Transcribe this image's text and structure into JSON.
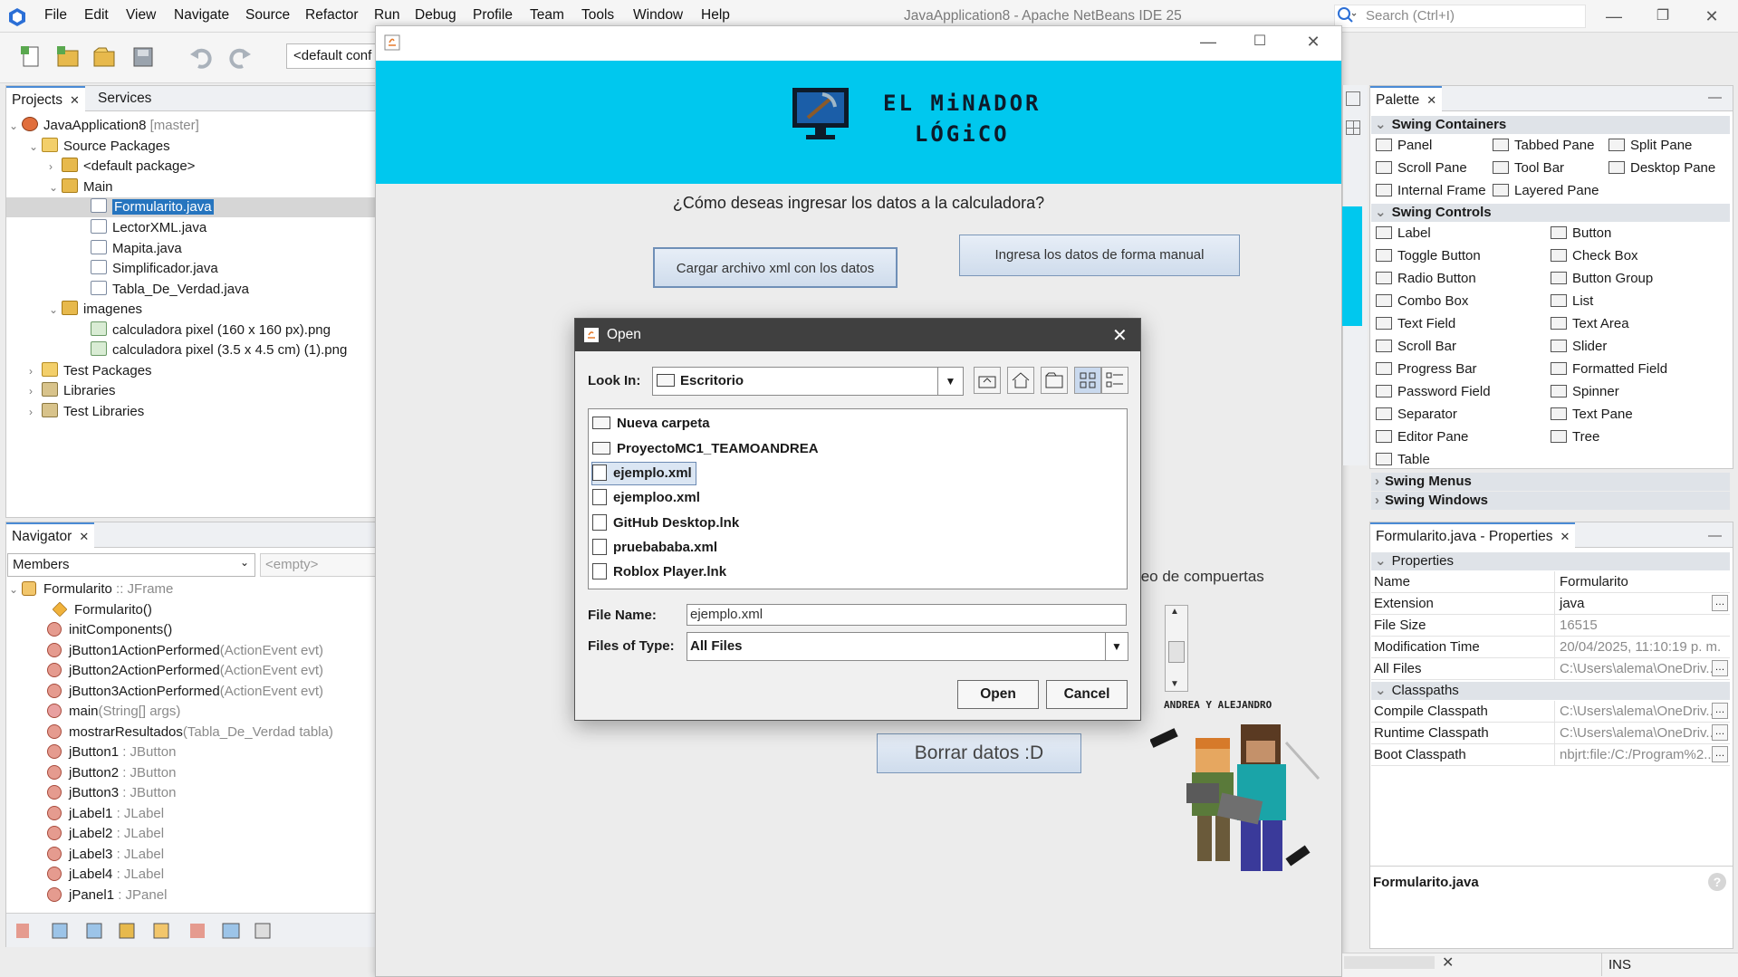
{
  "app": {
    "menus": [
      "File",
      "Edit",
      "View",
      "Navigate",
      "Source",
      "Refactor",
      "Run",
      "Debug",
      "Profile",
      "Team",
      "Tools",
      "Window",
      "Help"
    ],
    "title": "JavaApplication8 - Apache NetBeans IDE 25",
    "search_placeholder": "Search (Ctrl+I)",
    "config_combo": "<default conf"
  },
  "projects": {
    "tabs": [
      "Projects",
      "Services"
    ],
    "tree": [
      {
        "label": "JavaApplication8",
        "suffix": "[master]"
      },
      {
        "label": "Source Packages"
      },
      {
        "label": "<default package>"
      },
      {
        "label": "Main"
      },
      {
        "label": "Formularito.java"
      },
      {
        "label": "LectorXML.java"
      },
      {
        "label": "Mapita.java"
      },
      {
        "label": "Simplificador.java"
      },
      {
        "label": "Tabla_De_Verdad.java"
      },
      {
        "label": "imagenes"
      },
      {
        "label": "calculadora pixel (160 x 160 px).png"
      },
      {
        "label": "calculadora pixel (3.5 x 4.5 cm) (1).png"
      },
      {
        "label": "Test Packages"
      },
      {
        "label": "Libraries"
      },
      {
        "label": "Test Libraries"
      }
    ]
  },
  "navigator": {
    "tab": "Navigator",
    "filter": "Members",
    "empty": "<empty>",
    "items": [
      {
        "name": "Formularito",
        "type": ":: JFrame"
      },
      {
        "name": "Formularito()",
        "type": ""
      },
      {
        "name": "initComponents()",
        "type": ""
      },
      {
        "name": "jButton1ActionPerformed",
        "type": "(ActionEvent evt)"
      },
      {
        "name": "jButton2ActionPerformed",
        "type": "(ActionEvent evt)"
      },
      {
        "name": "jButton3ActionPerformed",
        "type": "(ActionEvent evt)"
      },
      {
        "name": "main",
        "type": "(String[] args)"
      },
      {
        "name": "mostrarResultados",
        "type": "(Tabla_De_Verdad tabla)"
      },
      {
        "name": "jButton1",
        "type": ": JButton"
      },
      {
        "name": "jButton2",
        "type": ": JButton"
      },
      {
        "name": "jButton3",
        "type": ": JButton"
      },
      {
        "name": "jLabel1",
        "type": ": JLabel"
      },
      {
        "name": "jLabel2",
        "type": ": JLabel"
      },
      {
        "name": "jLabel3",
        "type": ": JLabel"
      },
      {
        "name": "jLabel4",
        "type": ": JLabel"
      },
      {
        "name": "jPanel1",
        "type": ": JPanel"
      }
    ]
  },
  "app_window": {
    "banner_title": "EL MiNADOR\nLÓGiCO",
    "question": "¿Cómo deseas ingresar los datos a la calculadora?",
    "btn_xml": "Cargar archivo xml con los datos",
    "btn_manual": "Ingresa los datos de forma manual",
    "behind_text": "teo de compuertas",
    "btn_borrar": "Borrar datos :D",
    "characters_label": "ANDREA Y ALEJANDRO",
    "colors": {
      "banner": "#00c8ee"
    }
  },
  "open_dialog": {
    "title": "Open",
    "look_in_label": "Look In:",
    "look_in_value": "Escritorio",
    "files": [
      {
        "name": "Nueva carpeta",
        "kind": "dir"
      },
      {
        "name": "ProyectoMC1_TEAMOANDREA",
        "kind": "dir"
      },
      {
        "name": "ejemplo.xml",
        "kind": "file",
        "selected": true
      },
      {
        "name": "ejemploo.xml",
        "kind": "file"
      },
      {
        "name": "GitHub Desktop.lnk",
        "kind": "file"
      },
      {
        "name": "pruebababa.xml",
        "kind": "file"
      },
      {
        "name": "Roblox Player.lnk",
        "kind": "file"
      }
    ],
    "file_name_label": "File Name:",
    "file_name_value": "ejemplo.xml",
    "file_type_label": "Files of Type:",
    "file_type_value": "All Files",
    "open_button": "Open",
    "cancel_button": "Cancel"
  },
  "palette": {
    "tab": "Palette",
    "sections": {
      "containers": "Swing Containers",
      "controls": "Swing Controls",
      "menus": "Swing Menus",
      "windows": "Swing Windows"
    },
    "containers": [
      "Panel",
      "Tabbed Pane",
      "Split Pane",
      "Scroll Pane",
      "Tool Bar",
      "Desktop Pane",
      "Internal Frame",
      "Layered Pane"
    ],
    "controls": [
      "Label",
      "Button",
      "Toggle Button",
      "Check Box",
      "Radio Button",
      "Button Group",
      "Combo Box",
      "List",
      "Text Field",
      "Text Area",
      "Scroll Bar",
      "Slider",
      "Progress Bar",
      "Formatted Field",
      "Password Field",
      "Spinner",
      "Separator",
      "Text Pane",
      "Editor Pane",
      "Tree",
      "Table"
    ]
  },
  "properties": {
    "tab": "Formularito.java - Properties",
    "section_properties": "Properties",
    "section_classpaths": "Classpaths",
    "rows": [
      {
        "k": "Name",
        "v": "Formularito"
      },
      {
        "k": "Extension",
        "v": "java"
      },
      {
        "k": "File Size",
        "v": "16515"
      },
      {
        "k": "Modification Time",
        "v": "20/04/2025, 11:10:19 p. m."
      },
      {
        "k": "All Files",
        "v": "C:\\Users\\alema\\OneDriv..."
      }
    ],
    "classpaths": [
      {
        "k": "Compile Classpath",
        "v": "C:\\Users\\alema\\OneDriv..."
      },
      {
        "k": "Runtime Classpath",
        "v": "C:\\Users\\alema\\OneDriv..."
      },
      {
        "k": "Boot Classpath",
        "v": "nbjrt:file:/C:/Program%2..."
      }
    ],
    "footer_title": "Formularito.java"
  },
  "status": {
    "ins": "INS"
  }
}
